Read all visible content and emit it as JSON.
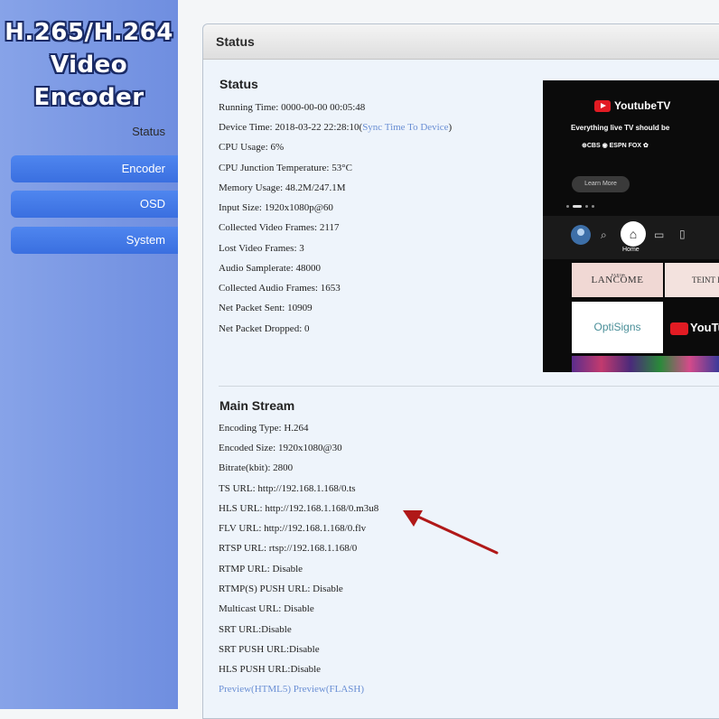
{
  "sidebar": {
    "logo_line1": "H.265/H.264",
    "logo_line2": "Video Encoder",
    "status_label": "Status",
    "items": [
      {
        "label": "Encoder"
      },
      {
        "label": "OSD"
      },
      {
        "label": "System"
      }
    ]
  },
  "panel": {
    "title": "Status"
  },
  "status": {
    "heading": "Status",
    "running_time": "Running Time: 0000-00-00 00:05:48",
    "device_time": "Device Time: 2018-03-22 22:28:10(",
    "sync_link": "Sync Time To Device",
    "device_time_close": ")",
    "cpu_usage": "CPU Usage: 6%",
    "cpu_temp": "CPU Junction Temperature: 53°C",
    "memory": "Memory Usage: 48.2M/247.1M",
    "input_size": "Input Size: 1920x1080p@60",
    "collected_video": "Collected Video Frames: 2117",
    "lost_video": "Lost Video Frames: 3",
    "audio_samplerate": "Audio Samplerate: 48000",
    "collected_audio": "Collected Audio Frames: 1653",
    "net_sent": "Net Packet Sent: 10909",
    "net_dropped": "Net Packet Dropped: 0"
  },
  "main_stream": {
    "heading": "Main Stream",
    "encoding_type": "Encoding Type: H.264",
    "encoded_size": "Encoded Size: 1920x1080@30",
    "bitrate": "Bitrate(kbit): 2800",
    "ts_url": "TS URL: http://192.168.1.168/0.ts",
    "hls_url": "HLS URL: http://192.168.1.168/0.m3u8",
    "flv_url": "FLV URL: http://192.168.1.168/0.flv",
    "rtsp_url": "RTSP URL: rtsp://192.168.1.168/0",
    "rtmp_url": "RTMP URL: Disable",
    "rtmps_push": "RTMP(S) PUSH URL: Disable",
    "multicast": "Multicast URL: Disable",
    "srt_url": "SRT URL:Disable",
    "srt_push": "SRT PUSH URL:Disable",
    "hls_push": "HLS PUSH URL:Disable",
    "preview_html5": "Preview(HTML5)",
    "preview_flash": "Preview(FLASH)"
  },
  "preview": {
    "brand": "YoutubeTV",
    "tagline": "Everything live TV should be",
    "networks": "⊕CBS ◉ ESPN FOX ✿",
    "learn_more": "Learn More",
    "home_label": "Home",
    "tile_lancome": "LANCÔME",
    "tile_lancome_sub": "PARIS",
    "tile_teint": "TEINT I",
    "tile_optisigns": "OptiSigns",
    "tile_youtube": "YouTu"
  },
  "colors": {
    "sidebar": "#7896e3",
    "nav_button": "#4479ea",
    "link": "#6a8fd4",
    "arrow": "#b01818"
  }
}
